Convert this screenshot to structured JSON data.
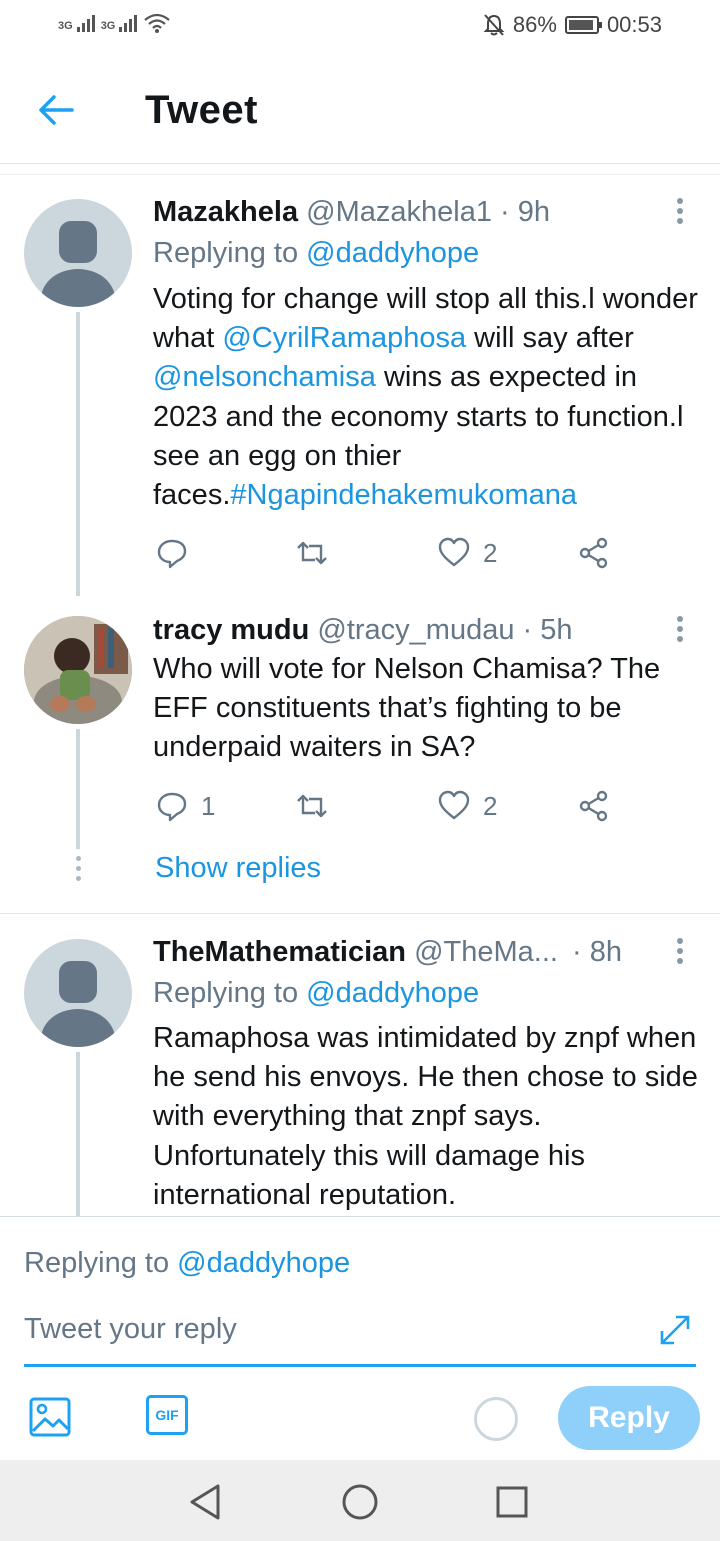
{
  "status_bar": {
    "network1": "3G",
    "network2": "3G",
    "battery": "86%",
    "time": "00:53"
  },
  "header": {
    "title": "Tweet"
  },
  "tweets": [
    {
      "name": "Mazakhela",
      "handle": "@Mazakhela1",
      "time": "· 9h",
      "replying_prefix": "Replying to",
      "replying_user": "@daddyhope",
      "text_parts": {
        "p1": "Voting for change will stop all this.l wonder what ",
        "m1": "@CyrilRamaphosa",
        "p2": " will say after ",
        "m2": "@nelsonchamisa",
        "p3": " wins as expected in 2023 and the economy starts to function.l see an egg on thier faces.",
        "m3": "#Ngapindehakemukomana"
      },
      "replies": "",
      "likes": "2"
    },
    {
      "name": "tracy mudu",
      "handle": "@tracy_mudau",
      "time": "· 5h",
      "text": "Who will vote for Nelson Chamisa? The EFF constituents that’s fighting to be underpaid waiters in SA?",
      "replies": "1",
      "likes": "2"
    },
    {
      "name": "TheMathematician",
      "handle": "@TheMa...",
      "time": "· 8h",
      "replying_prefix": "Replying to",
      "replying_user": "@daddyhope",
      "text": "Ramaphosa was intimidated by znpf when he send his envoys. He then chose to side with everything that znpf says. Unfortunately this will damage his international reputation."
    }
  ],
  "show_replies": "Show replies",
  "composer": {
    "replying_prefix": "Replying to",
    "replying_user": "@daddyhope",
    "placeholder": "Tweet your reply",
    "gif_label": "GIF",
    "reply_button": "Reply"
  },
  "colors": {
    "accent": "#1da1f2",
    "reply_button": "#8ed0f9"
  }
}
